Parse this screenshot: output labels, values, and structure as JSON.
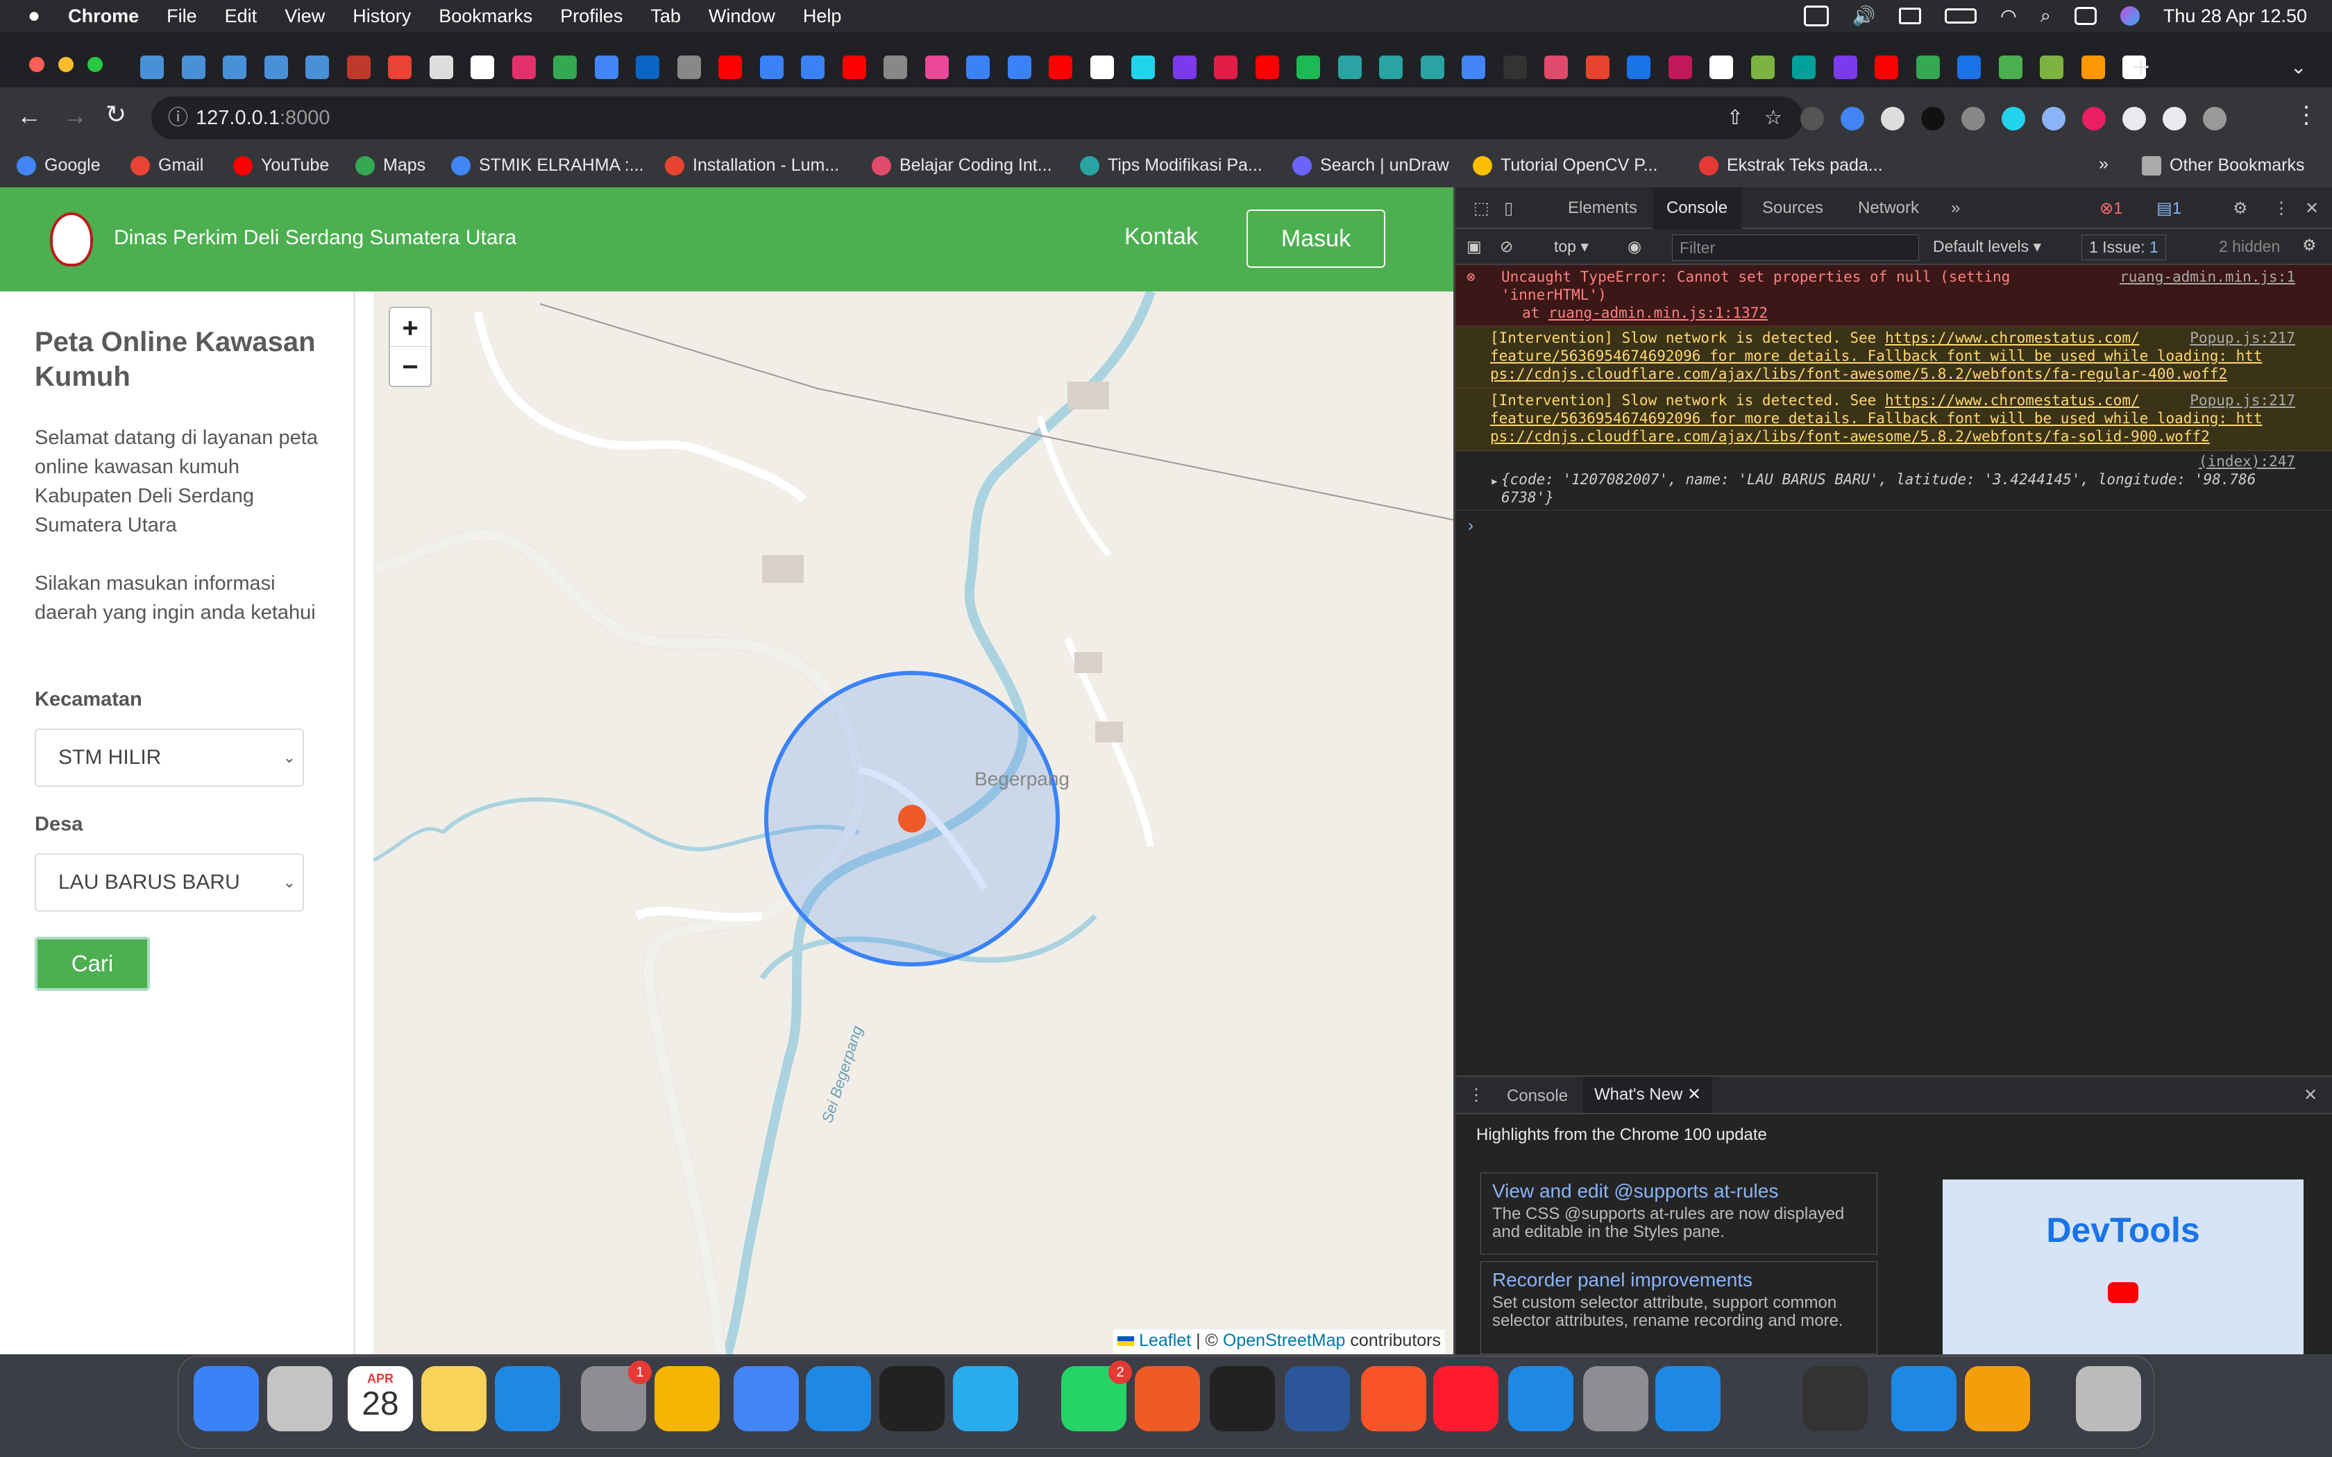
{
  "menubar": {
    "app_name": "Chrome",
    "items": [
      "File",
      "Edit",
      "View",
      "History",
      "Bookmarks",
      "Profiles",
      "Tab",
      "Window",
      "Help"
    ],
    "clock": "Thu 28 Apr  12.50"
  },
  "browser": {
    "url_host": "127.0.0.1",
    "url_port": ":8000",
    "bookmarks": [
      {
        "label": "Google",
        "icon": "google-icon",
        "color": "#4285f4"
      },
      {
        "label": "Gmail",
        "icon": "gmail-icon",
        "color": "#ea4335"
      },
      {
        "label": "YouTube",
        "icon": "youtube-icon",
        "color": "#ff0000"
      },
      {
        "label": "Maps",
        "icon": "maps-icon",
        "color": "#34a853"
      },
      {
        "label": "STMIK ELRAHMA :...",
        "icon": "globe-icon",
        "color": "#4285f4"
      },
      {
        "label": "Installation - Lum...",
        "icon": "lumen-icon",
        "color": "#e74430"
      },
      {
        "label": "Belajar Coding Int...",
        "icon": "leaf-icon",
        "color": "#e04a6b"
      },
      {
        "label": "Tips Modifikasi Pa...",
        "icon": "blog-icon",
        "color": "#2aa3a3"
      },
      {
        "label": "Search | unDraw",
        "icon": "undraw-icon",
        "color": "#6c63ff"
      },
      {
        "label": "Tutorial OpenCV P...",
        "icon": "opencv-icon",
        "color": "#ffbf00"
      },
      {
        "label": "Ekstrak Teks pada...",
        "icon": "plus-icon",
        "color": "#e53935"
      }
    ],
    "other_bookmarks": "Other Bookmarks"
  },
  "page": {
    "brand": "Dinas Perkim Deli Serdang Sumatera Utara",
    "nav_kontak": "Kontak",
    "nav_masuk": "Masuk",
    "sidebar": {
      "title": "Peta Online Kawasan Kumuh",
      "intro": "Selamat datang di layanan peta online kawasan kumuh Kabupaten Deli Serdang Sumatera Utara",
      "instruction": "Silakan masukan informasi daerah yang ingin anda ketahui",
      "kecamatan_label": "Kecamatan",
      "kecamatan_value": "STM HILIR",
      "desa_label": "Desa",
      "desa_value": "LAU BARUS BARU",
      "search_button": "Cari"
    },
    "map": {
      "zoom_in": "+",
      "zoom_out": "−",
      "place_label": "Begerpang",
      "river_label": "Sei Begerpang",
      "attribution_leaflet": "Leaflet",
      "attribution_sep": "| ©",
      "attribution_osm": "OpenStreetMap",
      "attribution_suffix": "contributors",
      "circle_color": "#3b82f6",
      "marker_color": "#f05a28"
    }
  },
  "devtools": {
    "tabs": [
      "Elements",
      "Console",
      "Sources",
      "Network"
    ],
    "active_tab": "Console",
    "error_count": "1",
    "message_count": "1",
    "context": "top",
    "filter_placeholder": "Filter",
    "levels": "Default levels",
    "issues": "1 Issue:",
    "issues_count": "1",
    "hidden": "2 hidden",
    "messages": {
      "error_line1": "Uncaught TypeError: Cannot set properties of null (setting",
      "error_line2": "'innerHTML')",
      "error_at": "at",
      "error_at_src": "ruang-admin.min.js:1:1372",
      "error_src": "ruang-admin.min.js:1",
      "warn1_line1_a": "[Intervention] Slow network is detected. See",
      "warn1_link": "https://www.chromestatus.com/",
      "warn1_line2": "feature/5636954674692096 for more details. Fallback font will be used while loading: htt",
      "warn1_line3": "ps://cdnjs.cloudflare.com/ajax/libs/font-awesome/5.8.2/webfonts/fa-regular-400.woff2",
      "warn1_src": "Popup.js:217",
      "warn2_line1_a": "[Intervention] Slow network is detected. See",
      "warn2_link": "https://www.chromestatus.com/",
      "warn2_line2": "feature/5636954674692096 for more details. Fallback font will be used while loading: htt",
      "warn2_line3": "ps://cdnjs.cloudflare.com/ajax/libs/font-awesome/5.8.2/webfonts/fa-solid-900.woff2",
      "warn2_src": "Popup.js:217",
      "log_src": "(index):247",
      "log_line1": "{code: '1207082007', name: 'LAU BARUS BARU', latitude: '3.4244145', longitude: '98.786",
      "log_line2": "6738'}"
    },
    "drawer": {
      "tab_console": "Console",
      "tab_whats_new": "What's New",
      "headline": "Highlights from the Chrome 100 update",
      "card1_title": "View and edit @supports at-rules",
      "card1_body": "The CSS @supports at-rules are now displayed and editable in the Styles pane.",
      "card2_title": "Recorder panel improvements",
      "card2_body": "Set custom selector attribute, support common selector attributes, rename recording and more.",
      "promo_title": "DevTools"
    }
  },
  "dock": {
    "calendar_month": "APR",
    "calendar_day": "28",
    "settings_badge": "1",
    "whatsapp_badge": "2"
  }
}
